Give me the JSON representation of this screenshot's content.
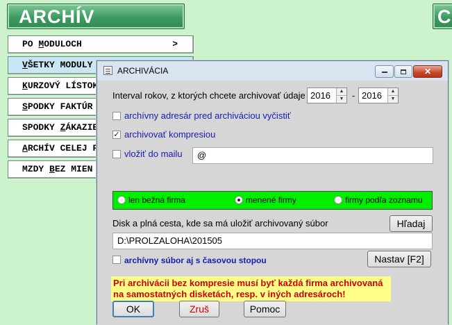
{
  "app": {
    "title": "ARCHÍV",
    "right_banner_text": "C"
  },
  "menu": {
    "items": [
      {
        "label_pre": "PO ",
        "label_u": "M",
        "label_post": "ODULOCH",
        "arrow": ">"
      },
      {
        "label_pre": "",
        "label_u": "V",
        "label_post": "ŠETKY MODULY",
        "arrow": ""
      },
      {
        "label_pre": "",
        "label_u": "K",
        "label_post": "URZOVÝ LÍSTOK",
        "arrow": ""
      },
      {
        "label_pre": "",
        "label_u": "S",
        "label_post": "PODKY FAKTÚR",
        "arrow": ""
      },
      {
        "label_pre": "SPODKY ",
        "label_u": "Z",
        "label_post": "ÁKAZIEK",
        "arrow": ""
      },
      {
        "label_pre": "",
        "label_u": "A",
        "label_post": "RCHÍV CELEJ FIRMY",
        "arrow": ""
      },
      {
        "label_pre": "MZDY ",
        "label_u": "B",
        "label_post": "EZ MIEN",
        "arrow": ""
      }
    ]
  },
  "dialog": {
    "title": "ARCHIVÁCIA",
    "close_symbol": "✕",
    "interval_label": "Interval rokov, z ktorých chcete archivovať údaje",
    "year_from": "2016",
    "year_separator": "-",
    "year_to": "2016",
    "spin_up": "▲",
    "spin_down": "▼",
    "checkbox_clear_label": "archívny adresár pred archiváciou vyčistiť",
    "checkbox_clear_checked": false,
    "checkbox_compress_label": "archivovať kompresiou",
    "checkbox_compress_checked": true,
    "checkbox_compress_mark": "✓",
    "checkbox_mail_label": "vložiť do mailu",
    "checkbox_mail_checked": false,
    "mail_value": "@",
    "radio_options": [
      {
        "label": "len bežná firma",
        "selected": false
      },
      {
        "label": "menené firmy",
        "selected": true
      },
      {
        "label": "firmy podľa zoznamu",
        "selected": false
      }
    ],
    "path_label": "Disk a plná cesta, kde sa má uložiť archivovaný súbor",
    "path_value": "D:\\PROLZALOHA\\201505",
    "browse_button": "Hľadaj",
    "checkbox_timestamp_label": "archívny súbor aj s časovou stopou",
    "checkbox_timestamp_checked": false,
    "setup_button": "Nastav [F2]",
    "warning_line1": "Pri archivácii bez kompresie musí byť každá firma archivovaná",
    "warning_line2": "na samostatných disketách, resp. v iných adresároch!",
    "ok_button": "OK",
    "cancel_button": "Zruš",
    "help_button": "Pomoc"
  },
  "colors": {
    "background": "#cdf3cd",
    "banner_green": "#3e9a63",
    "radio_group_green": "#00ee00",
    "warning_bg": "#ffff88",
    "warning_text": "#cc0000",
    "blue_label": "#1a1ab0",
    "cancel_text": "#cc0000"
  }
}
